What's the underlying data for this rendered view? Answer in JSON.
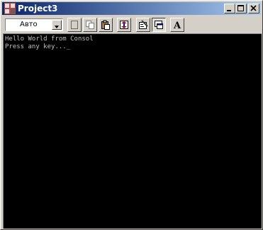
{
  "window": {
    "title": "Project3"
  },
  "toolbar": {
    "font_selector_value": "Авто",
    "buttons": [
      "mark-icon",
      "copy-icon",
      "paste-icon",
      "scroll-icon",
      "properties-icon",
      "background-icon",
      "font-icon"
    ],
    "font_button_glyph": "A"
  },
  "console": {
    "lines": [
      "Hello World from Consol",
      "Press any key..._"
    ]
  },
  "colors": {
    "titlebar_start": "#0a246a",
    "titlebar_end": "#a6caf0",
    "console_bg": "#000000",
    "console_text": "#c0c0c0"
  }
}
